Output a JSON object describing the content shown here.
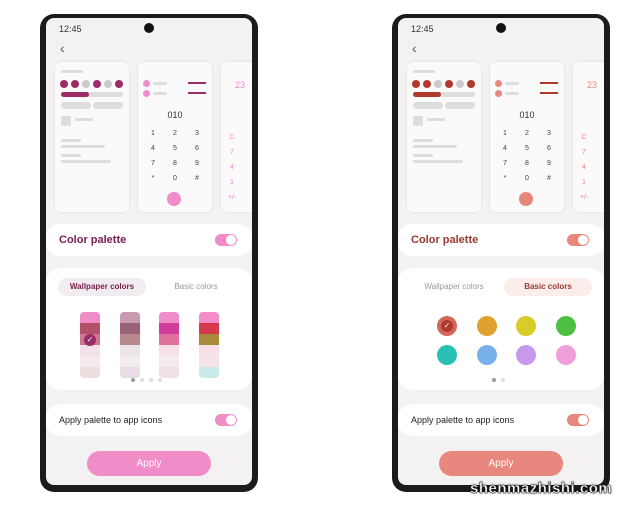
{
  "phones": [
    {
      "status_time": "12:45",
      "accent": "#f08cc8",
      "accent_dark": "#9b2a66",
      "title_color": "#7a2050",
      "dialer": {
        "number": "010",
        "keys": [
          "1",
          "2",
          "3",
          "4",
          "5",
          "6",
          "7",
          "8",
          "9",
          "*",
          "0",
          "#"
        ]
      },
      "calc": {
        "display": "23",
        "keys": [
          "C",
          "7",
          "4",
          "1",
          "+/-"
        ]
      },
      "color_palette": {
        "label": "Color palette",
        "enabled": true
      },
      "tabs": [
        {
          "label": "Wallpaper colors",
          "selected": true
        },
        {
          "label": "Basic colors",
          "selected": false
        }
      ],
      "swatches": [
        {
          "colors": [
            "#f08cc8",
            "#b5506a",
            "#c9788e",
            "#f2e3ea",
            "#f4eaee",
            "#ecdede"
          ],
          "selected": true
        },
        {
          "colors": [
            "#c89ab2",
            "#9a6078",
            "#b88a90",
            "#ede3e8",
            "#f3ecef",
            "#e8dde4"
          ],
          "selected": false
        },
        {
          "colors": [
            "#f08cc8",
            "#d23c9a",
            "#e0709c",
            "#f8e0ea",
            "#f6ecf0",
            "#f0e0e6"
          ],
          "selected": false
        },
        {
          "colors": [
            "#f48cc8",
            "#d63a4a",
            "#a88a3a",
            "#f8e0e8",
            "#f4e6e6",
            "#c8e8ea"
          ],
          "selected": false
        }
      ],
      "page_dots": {
        "count": 4,
        "active": 0
      },
      "apply_icons": {
        "label": "Apply palette to app icons",
        "enabled": true
      },
      "apply_label": "Apply"
    },
    {
      "status_time": "12:45",
      "accent": "#e8877d",
      "accent_dark": "#b0382c",
      "title_color": "#9a3a30",
      "dialer": {
        "number": "010",
        "keys": [
          "1",
          "2",
          "3",
          "4",
          "5",
          "6",
          "7",
          "8",
          "9",
          "*",
          "0",
          "#"
        ]
      },
      "calc": {
        "display": "23",
        "keys": [
          "C",
          "7",
          "4",
          "1",
          "+/-"
        ]
      },
      "color_palette": {
        "label": "Color palette",
        "enabled": true
      },
      "tabs": [
        {
          "label": "Wallpaper colors",
          "selected": false
        },
        {
          "label": "Basic colors",
          "selected": true
        }
      ],
      "basic_colors": [
        {
          "color": "#d0665c",
          "selected": true
        },
        {
          "color": "#e0a030",
          "selected": false
        },
        {
          "color": "#d8cc28",
          "selected": false
        },
        {
          "color": "#4cc040",
          "selected": false
        },
        {
          "color": "#28c0b4",
          "selected": false
        },
        {
          "color": "#78b0ec",
          "selected": false
        },
        {
          "color": "#c898ec",
          "selected": false
        },
        {
          "color": "#f0a0d8",
          "selected": false
        }
      ],
      "page_dots": {
        "count": 2,
        "active": 0
      },
      "apply_icons": {
        "label": "Apply palette to app icons",
        "enabled": true
      },
      "apply_label": "Apply"
    }
  ],
  "watermark": "shenmazhishi.com"
}
